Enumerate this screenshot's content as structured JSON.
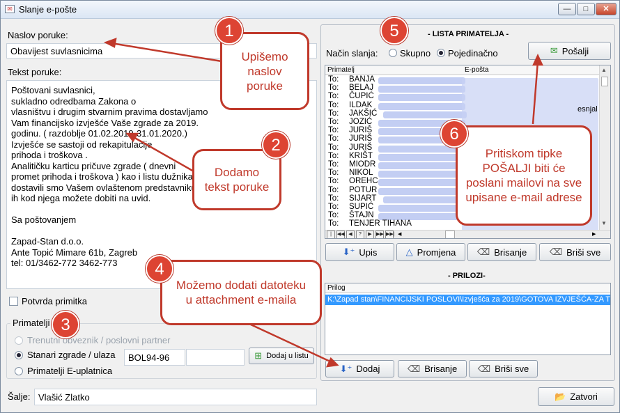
{
  "window": {
    "title": "Slanje e-pošte",
    "min": "—",
    "max": "□",
    "close": "✕"
  },
  "left": {
    "subject_label": "Naslov poruke:",
    "subject_value": "Obavijest suvlasnicima",
    "body_label": "Tekst poruke:",
    "body_value": "Poštovani suvlasnici,\nsukladno odredbama Zakona o\nvlasništvu i drugim stvarnim pravima dostavljamo\nVam financijsko izvješće Vaše zgrade za 2019.\ngodinu. ( razdoblje 01.02.2019-31.01.2020.)\nIzvješće se sastoji od rekapitulacije\nprihoda i troškova .\nAnalitičku karticu pričuve zgrade ( dnevni\npromet prihoda i troškova ) kao i listu dužnika\ndostavili smo Vašem ovlaštenom predstavniku\nih kod njega možete dobiti na uvid.\n\nSa poštovanjem\n\nZapad-Stan d.o.o.\nAnte Topić Mimare 61b, Zagreb\ntel: 01/3462-772 3462-773",
    "receipt_label": "Potvrda primitka",
    "recipients_title": "Primatelji",
    "opt1": "Trenutni obveznik / poslovni partner",
    "opt2": "Stanari zgrade / ulaza",
    "opt3": "Primatelji E-uplatnica",
    "building_code": "BOL94-96",
    "add_to_list": "Dodaj u listu",
    "sender_label": "Šalje:",
    "sender_value": "Vlašić Zlatko"
  },
  "right": {
    "list_title": "- LISTA PRIMATELJA -",
    "mode_label": "Način slanja:",
    "mode_group": "Skupno",
    "mode_single": "Pojedinačno",
    "send_label": "Pošalji",
    "col_recipient": "Primatelj",
    "col_email": "E-pošta",
    "recipients": [
      {
        "prefix": "To:",
        "name": "BANJA"
      },
      {
        "prefix": "To:",
        "name": "BELAJ"
      },
      {
        "prefix": "To:",
        "name": "ČUPIĆ"
      },
      {
        "prefix": "To:",
        "name": "ILDAK"
      },
      {
        "prefix": "To:",
        "name": "JAKŠIĆ"
      },
      {
        "prefix": "To:",
        "name": "JOZIĆ"
      },
      {
        "prefix": "To:",
        "name": "JURIŠ"
      },
      {
        "prefix": "To:",
        "name": "JURIŠ"
      },
      {
        "prefix": "To:",
        "name": "JURIŠ"
      },
      {
        "prefix": "To:",
        "name": "KRIŠT"
      },
      {
        "prefix": "To:",
        "name": "MIODR"
      },
      {
        "prefix": "To:",
        "name": "NIKOL"
      },
      {
        "prefix": "To:",
        "name": "OREHC"
      },
      {
        "prefix": "To:",
        "name": "POTUR"
      },
      {
        "prefix": "To:",
        "name": "SIJART"
      },
      {
        "prefix": "To:",
        "name": "SUPIĆ"
      },
      {
        "prefix": "To:",
        "name": "ŠTAJN"
      },
      {
        "prefix": "To:",
        "name": "TENJER TIHANA"
      }
    ],
    "email_fragment": "esnjal",
    "btn_add": "Upis",
    "btn_change": "Promjena",
    "btn_delete": "Brisanje",
    "btn_delete_all": "Briši sve",
    "attach_title": "- PRILOZI-",
    "col_attachment": "Prilog",
    "attachment_path": "K:\\Zapad stan\\FINANCIJSKI POSLOVI\\Izvješća za 2019\\GOTOVA IZVJEŠĆA-ZA T",
    "att_add": "Dodaj",
    "att_delete": "Brisanje",
    "att_delete_all": "Briši sve",
    "close_label": "Zatvori"
  },
  "callouts": {
    "c1": {
      "num": "1",
      "text": "Upišemo naslov poruke"
    },
    "c2": {
      "num": "2",
      "text": "Dodamo tekst poruke"
    },
    "c4": {
      "num": "4",
      "text": "Možemo dodati datoteku u attachment e-maila"
    },
    "c5": {
      "num": "5"
    },
    "c3": {
      "num": "3"
    },
    "c6": {
      "num": "6",
      "text": "Pritiskom tipke POŠALJI biti će poslani mailovi na sve upisane e-mail adrese"
    }
  },
  "colors": {
    "callout": "#c0392b",
    "badge": "#dd4433",
    "selection": "#3399ff"
  }
}
